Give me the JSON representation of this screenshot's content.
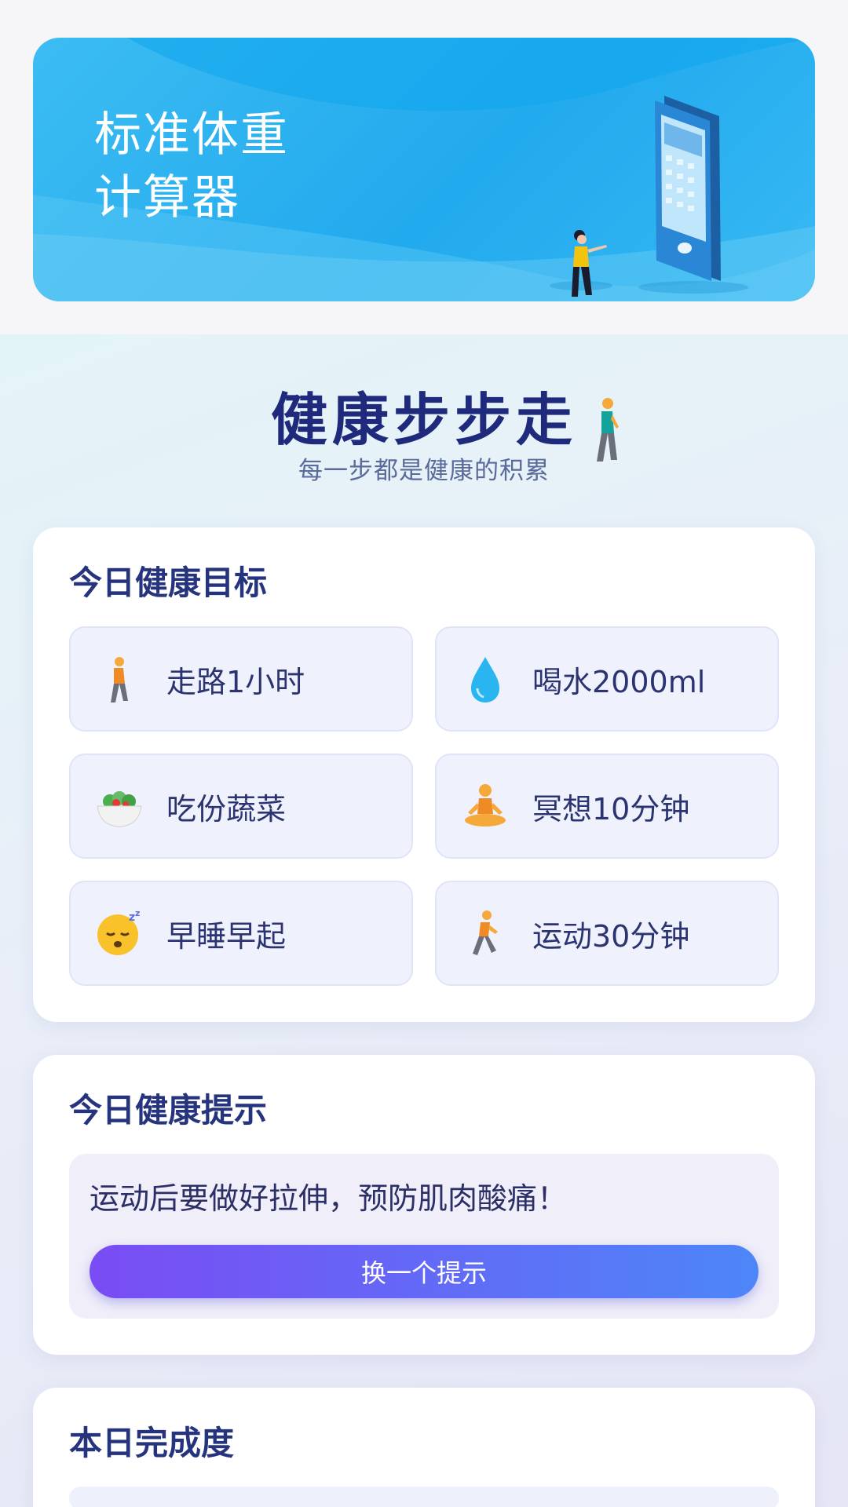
{
  "banner": {
    "title_line1": "标准体重",
    "title_line2": "计算器"
  },
  "hero": {
    "title": "健康步步走",
    "subtitle": "每一步都是健康的积累",
    "icon": "walking-person-icon"
  },
  "goals": {
    "title": "今日健康目标",
    "items": [
      {
        "icon": "walking-person-icon",
        "label": "走路1小时"
      },
      {
        "icon": "water-drop-icon",
        "label": "喝水2000ml"
      },
      {
        "icon": "salad-bowl-icon",
        "label": "吃份蔬菜"
      },
      {
        "icon": "meditation-icon",
        "label": "冥想10分钟"
      },
      {
        "icon": "sleeping-face-icon",
        "label": "早睡早起"
      },
      {
        "icon": "running-person-icon",
        "label": "运动30分钟"
      }
    ]
  },
  "tips": {
    "title": "今日健康提示",
    "text": "运动后要做好拉伸，预防肌肉酸痛！",
    "button_label": "换一个提示"
  },
  "progress": {
    "title": "本日完成度"
  },
  "colors": {
    "banner": "#22aaee",
    "title_text": "#1f2a7c",
    "button_start": "#7a4cf4",
    "button_end": "#4d86f8"
  }
}
